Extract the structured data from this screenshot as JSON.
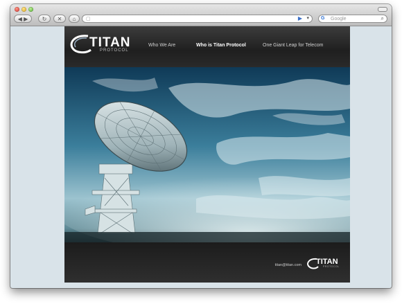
{
  "browser": {
    "search_placeholder": "Google",
    "back_icon": "back-arrow-icon",
    "forward_icon": "forward-arrow-icon",
    "home_icon": "home-icon"
  },
  "site": {
    "logo": {
      "name": "TITAN",
      "tagline": "PROTOCOL"
    },
    "nav": [
      {
        "label": "Who We Are",
        "active": false
      },
      {
        "label": "Who is Titan Protocol",
        "active": true
      },
      {
        "label": "One Giant Leap for Telecom",
        "active": false
      }
    ],
    "hero_image": "satellite-dish-sky",
    "footer": {
      "email": "titan@titan.com",
      "logo_name": "TITAN",
      "logo_tagline": "PROTOCOL"
    }
  },
  "colors": {
    "page_bg": "#222222",
    "nav_active": "#ffffff",
    "nav_inactive": "#d0d0d0",
    "desktop_bg": "#d9e3e9"
  }
}
